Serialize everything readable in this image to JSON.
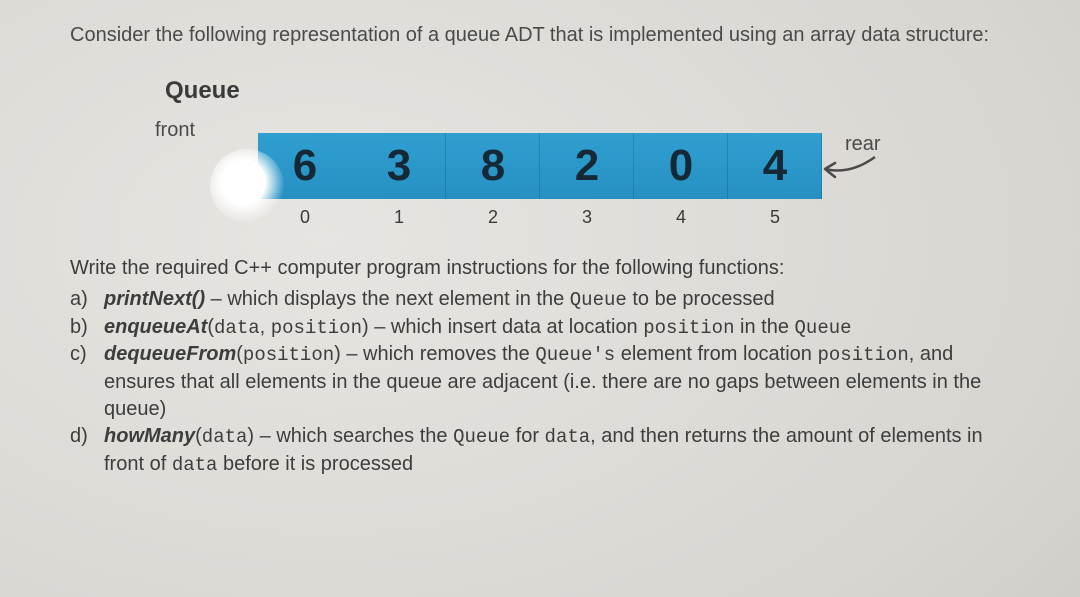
{
  "intro": "Consider the following representation of a queue ADT that is implemented using an array data structure:",
  "queue_title": "Queue",
  "front_label": "front",
  "rear_label": "rear",
  "cells": [
    "6",
    "3",
    "8",
    "2",
    "0",
    "4"
  ],
  "indices": [
    "0",
    "1",
    "2",
    "3",
    "4",
    "5"
  ],
  "prompt": "Write the required C++ computer program instructions for the following functions:",
  "items": {
    "a": {
      "label": "a)",
      "fn": "printNext()",
      "rest1": " – which displays the next element in the ",
      "kw1": "Queue",
      "rest2": " to be processed"
    },
    "b": {
      "label": "b)",
      "fn": "enqueueAt",
      "args_open": "(",
      "arg1": "data",
      "args_sep": ", ",
      "arg2": "position",
      "args_close": ")",
      "rest1": " – which insert data at location ",
      "kw1": "position",
      "rest2": " in the ",
      "kw2": "Queue"
    },
    "c": {
      "label": "c)",
      "fn": "dequeueFrom",
      "args_open": "(",
      "arg1": "position",
      "args_close": ")",
      "rest1": " – which removes the ",
      "kw1": "Queue's",
      "rest2": " element from location ",
      "kw2": "position",
      "rest3": ", and ensures that all elements in the queue are adjacent (i.e. there are no gaps between elements in the queue)"
    },
    "d": {
      "label": "d)",
      "fn": "howMany",
      "args_open": "(",
      "arg1": "data",
      "args_close": ")",
      "rest1": " – which searches the ",
      "kw1": "Queue",
      "rest2": " for ",
      "kw2": "data",
      "rest3": ", and then returns the amount of elements in front of ",
      "kw3": "data",
      "rest4": " before it is processed"
    }
  }
}
